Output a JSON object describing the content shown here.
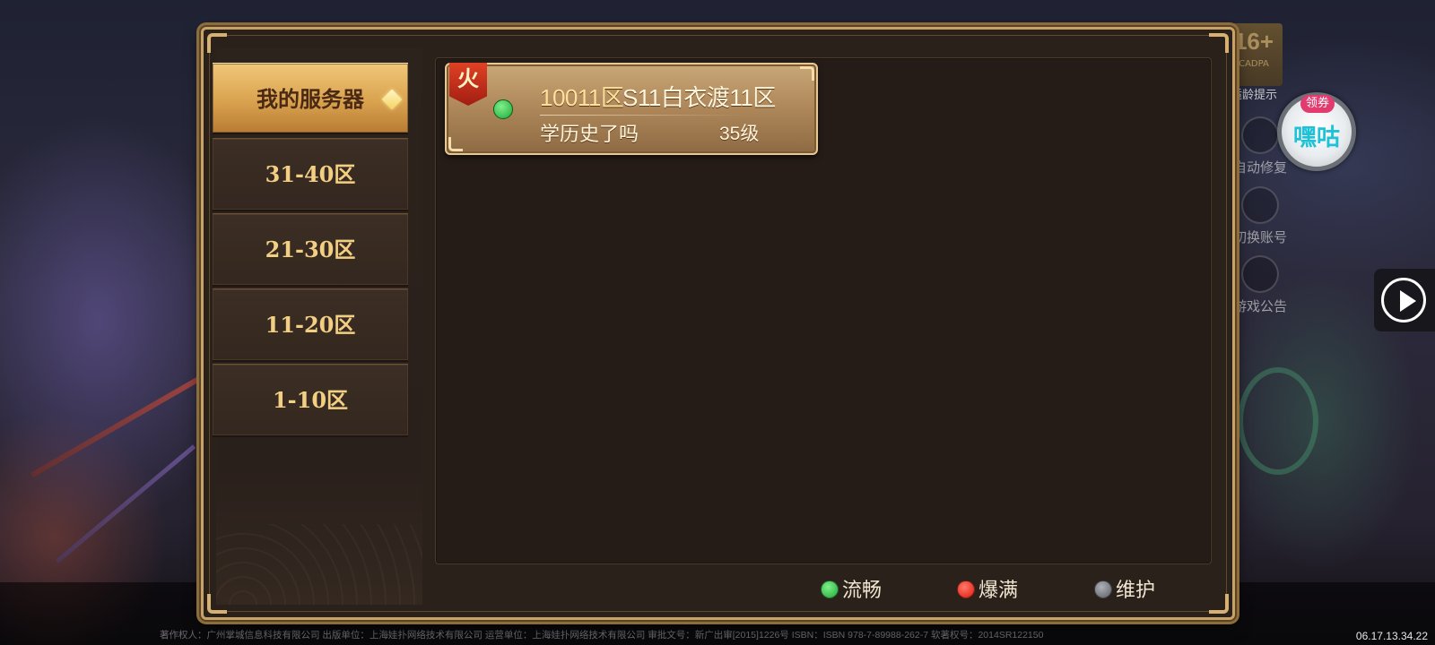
{
  "background": {
    "copyright_line": "著作权人：广州掌城信息科技有限公司 出版单位：上海娃扑网络技术有限公司 运营单位：上海娃扑网络技术有限公司 审批文号：新广出审[2015]1226号 ISBN：ISBN 978-7-89988-262-7 软著权号：2014SR122150",
    "timestamp": "06.17.13.34.22"
  },
  "hud": {
    "age_rating": "16+",
    "age_rating_sub": "CADPA",
    "age_label": "适龄提示",
    "repair_label": "自动修复",
    "switch_account_label": "切换账号",
    "notice_label": "游戏公告",
    "coupon_tag": "领券",
    "coupon_brand": "嘿咕"
  },
  "sidebar": {
    "tabs": [
      {
        "label": "我的服务器",
        "active": true
      },
      {
        "label": "31-40区",
        "active": false
      },
      {
        "label": "21-30区",
        "active": false
      },
      {
        "label": "11-20区",
        "active": false
      },
      {
        "label": "1-10区",
        "active": false
      }
    ]
  },
  "servers": [
    {
      "badge": "火",
      "status": "smooth",
      "zone_id": "10011区",
      "name": "S11白衣渡11区",
      "character": "学历史了吗",
      "level": "35级"
    }
  ],
  "legend": {
    "smooth": "流畅",
    "full": "爆满",
    "maintenance": "维护"
  },
  "colors": {
    "status_smooth": "#1fa83a",
    "status_full": "#e0160c",
    "status_maintenance": "#5b5f66",
    "tab_active": "#d9a24f",
    "tab_text": "#f3cf83",
    "frame_gold": "#c7a36a"
  }
}
